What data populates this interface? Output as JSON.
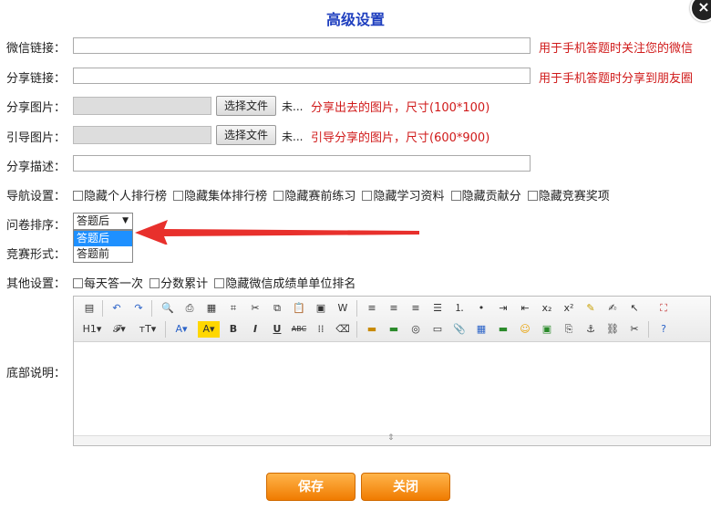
{
  "dialog": {
    "title": "高级设置",
    "close_label": "×"
  },
  "form": {
    "wechat_link": {
      "label": "微信链接：",
      "value": "",
      "hint": "用于手机答题时关注您的微信"
    },
    "share_link": {
      "label": "分享链接：",
      "value": "",
      "hint": "用于手机答题时分享到朋友圈"
    },
    "share_image": {
      "label": "分享图片：",
      "button": "选择文件",
      "file_status": "未...",
      "hint": "分享出去的图片，尺寸(100*100)"
    },
    "guide_image": {
      "label": "引导图片：",
      "button": "选择文件",
      "file_status": "未...",
      "hint": "引导分享的图片，尺寸(600*900)"
    },
    "share_desc": {
      "label": "分享描述：",
      "value": ""
    },
    "nav_settings": {
      "label": "导航设置：",
      "options": [
        "隐藏个人排行榜",
        "隐藏集体排行榜",
        "隐藏赛前练习",
        "隐藏学习资料",
        "隐藏贡献分",
        "隐藏竞赛奖项"
      ]
    },
    "questionnaire_order": {
      "label": "问卷排序：",
      "selected": "答题后",
      "options": [
        "答题后",
        "答题前"
      ],
      "caret": "▼"
    },
    "competition_form": {
      "label": "竞赛形式："
    },
    "other_settings": {
      "label": "其他设置：",
      "options": [
        "每天答一次",
        "分数累计",
        "隐藏微信成绩单单位排名"
      ]
    },
    "footer_desc": {
      "label": "底部说明："
    }
  },
  "editor": {
    "toolbar_row1": [
      "source-icon",
      "undo-icon",
      "redo-icon",
      "preview-icon",
      "print-icon",
      "template-icon",
      "code-icon",
      "cut-icon",
      "copy-icon",
      "paste-icon",
      "paste-text-icon",
      "paste-word-icon",
      "align-left-icon",
      "align-center-icon",
      "align-right-icon",
      "justify-icon",
      "ordered-list-icon",
      "unordered-list-icon",
      "indent-icon",
      "outdent-icon",
      "subscript-icon",
      "superscript-icon",
      "clear-format-icon",
      "select-all-icon",
      "cursor-icon",
      "fullscreen-icon"
    ],
    "toolbar_row2_labels": {
      "heading": "H1",
      "font": "𝓕",
      "size": "тT",
      "font_color": "A",
      "bg_color": "A",
      "bold": "B",
      "italic": "I",
      "underline": "U",
      "strike": "ABC"
    },
    "resize_glyph": "⇕"
  },
  "buttons": {
    "save": "保存",
    "close": "关闭"
  },
  "colors": {
    "title": "#1f3fbf",
    "hint": "#d01a1a",
    "button": "#f07b00",
    "selected_option": "#1e90ff",
    "arrow": "#e8302c"
  }
}
